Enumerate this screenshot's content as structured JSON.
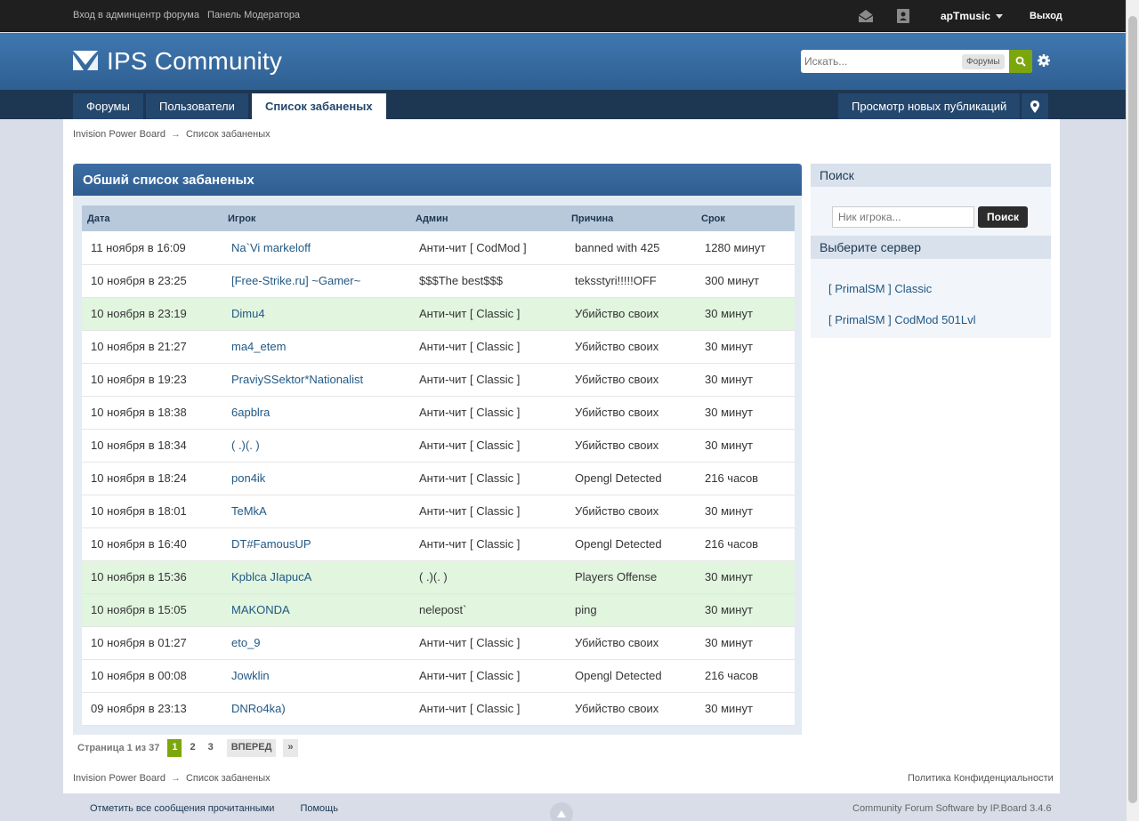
{
  "topbar": {
    "links": [
      "Вход в админцентр форума",
      "Панель Модератора"
    ],
    "username": "apTmusic",
    "logout": "Выход"
  },
  "header": {
    "logo_text": "IPS Community",
    "search_placeholder": "Искать...",
    "search_scope": "Форумы"
  },
  "nav": {
    "tabs": [
      "Форумы",
      "Пользователи",
      "Список забаненых"
    ],
    "active_tab": "Список забаненых",
    "new_posts": "Просмотр новых публикаций"
  },
  "breadcrumb": {
    "root": "Invision Power Board",
    "current": "Список забаненых"
  },
  "bans": {
    "title": "Обший список забаненых",
    "columns": [
      "Дата",
      "Игрок",
      "Админ",
      "Причина",
      "Срок"
    ],
    "rows": [
      {
        "date": "11 ноября в 16:09",
        "player": "Na`Vi markeloff",
        "admin": "Анти-чит [ CodMod ]",
        "reason": "banned with 425",
        "term": "1280 минут",
        "highlight": false
      },
      {
        "date": "10 ноября в 23:25",
        "player": "[Free-Strike.ru] ~Gamer~",
        "admin": "$$$The best$$$",
        "reason": "teksstyri!!!!!OFF",
        "term": "300 минут",
        "highlight": false
      },
      {
        "date": "10 ноября в 23:19",
        "player": "Dimu4",
        "admin": "Анти-чит [ Classic ]",
        "reason": "Убийство своих",
        "term": "30 минут",
        "highlight": true
      },
      {
        "date": "10 ноября в 21:27",
        "player": "ma4_etem",
        "admin": "Анти-чит [ Classic ]",
        "reason": "Убийство своих",
        "term": "30 минут",
        "highlight": false
      },
      {
        "date": "10 ноября в 19:23",
        "player": "PraviySSektor*Nationalist",
        "admin": "Анти-чит [ Classic ]",
        "reason": "Убийство своих",
        "term": "30 минут",
        "highlight": false
      },
      {
        "date": "10 ноября в 18:38",
        "player": "6apblra",
        "admin": "Анти-чит [ Classic ]",
        "reason": "Убийство своих",
        "term": "30 минут",
        "highlight": false
      },
      {
        "date": "10 ноября в 18:34",
        "player": "( .)(. )",
        "admin": "Анти-чит [ Classic ]",
        "reason": "Убийство своих",
        "term": "30 минут",
        "highlight": false
      },
      {
        "date": "10 ноября в 18:24",
        "player": "pon4ik",
        "admin": "Анти-чит [ Classic ]",
        "reason": "Opengl Detected",
        "term": "216 часов",
        "highlight": false
      },
      {
        "date": "10 ноября в 18:01",
        "player": "TeMkA",
        "admin": "Анти-чит [ Classic ]",
        "reason": "Убийство своих",
        "term": "30 минут",
        "highlight": false
      },
      {
        "date": "10 ноября в 16:40",
        "player": "DT#FamousUP",
        "admin": "Анти-чит [ Classic ]",
        "reason": "Opengl Detected",
        "term": "216 часов",
        "highlight": false
      },
      {
        "date": "10 ноября в 15:36",
        "player": "Kpblca JIapucA",
        "admin": "( .)(. )",
        "reason": "Players Offense",
        "term": "30 минут",
        "highlight": true
      },
      {
        "date": "10 ноября в 15:05",
        "player": "MAKONDA",
        "admin": "nelepost`",
        "reason": "ping",
        "term": "30 минут",
        "highlight": true
      },
      {
        "date": "10 ноября в 01:27",
        "player": "eto_9",
        "admin": "Анти-чит [ Classic ]",
        "reason": "Убийство своих",
        "term": "30 минут",
        "highlight": false
      },
      {
        "date": "10 ноября в 00:08",
        "player": "Jowklin",
        "admin": "Анти-чит [ Classic ]",
        "reason": "Opengl Detected",
        "term": "216 часов",
        "highlight": false
      },
      {
        "date": "09 ноября в 23:13",
        "player": "DNRo4ka)",
        "admin": "Анти-чит [ Classic ]",
        "reason": "Убийство своих",
        "term": "30 минут",
        "highlight": false
      }
    ]
  },
  "pagination": {
    "label": "Страница 1 из 37",
    "pages": [
      "1",
      "2",
      "3"
    ],
    "current": "1",
    "next": "ВПЕРЕД",
    "last": "»"
  },
  "sidebar": {
    "search_title": "Поиск",
    "search_placeholder": "Ник игрока...",
    "search_button": "Поиск",
    "servers_title": "Выберите сервер",
    "servers": [
      "[ PrimalSM ] Classic",
      "[ PrimalSM ] CodMod 501Lvl"
    ]
  },
  "footer": {
    "privacy": "Политика Конфиденциальности",
    "mark_read": "Отметить все сообщения прочитанными",
    "help": "Помощь",
    "copyright": "Community Forum Software by IP.Board 3.4.6"
  },
  "colors": {
    "accent_green": "#7ba60d",
    "header_blue": "#3f78b0",
    "nav_dark": "#1d3652",
    "highlight_row": "#e1f5df"
  }
}
